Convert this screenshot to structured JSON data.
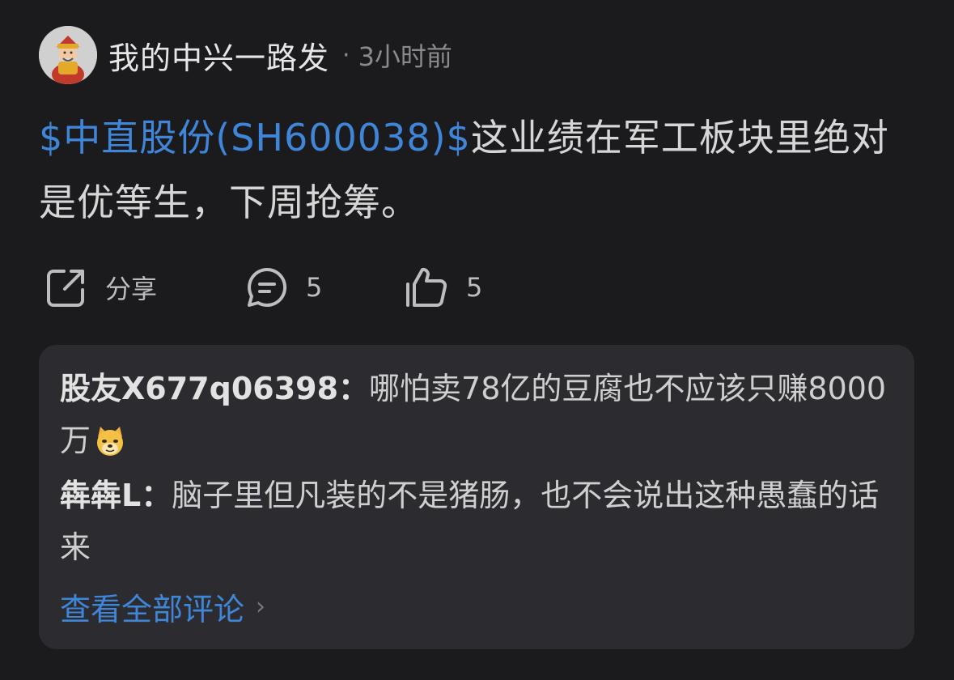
{
  "post": {
    "author": "我的中兴一路发",
    "separator": "·",
    "time": "3小时前",
    "stock_tag": "$中直股份(SH600038)$",
    "body": "这业绩在军工板块里绝对是优等生，下周抢筹。"
  },
  "actions": {
    "share_icon": "share-icon",
    "share_label": "分享",
    "comment_icon": "comment-icon",
    "comment_count": "5",
    "like_icon": "thumbs-up-icon",
    "like_count": "5"
  },
  "comments": [
    {
      "author": "股友X677q06398：",
      "text": "哪怕卖78亿的豆腐也不应该只赚8000万",
      "emoji": "doge-emoji-icon"
    },
    {
      "author": "犇犇L：",
      "text": "脑子里但凡装的不是猪肠，也不会说出这种愚蠢的话来"
    }
  ],
  "view_all": {
    "label": "查看全部评论",
    "chevron": "›"
  },
  "colors": {
    "background": "#1b1b1e",
    "card": "#2c2c30",
    "link": "#3f86d8",
    "muted": "#8a8a8e"
  }
}
